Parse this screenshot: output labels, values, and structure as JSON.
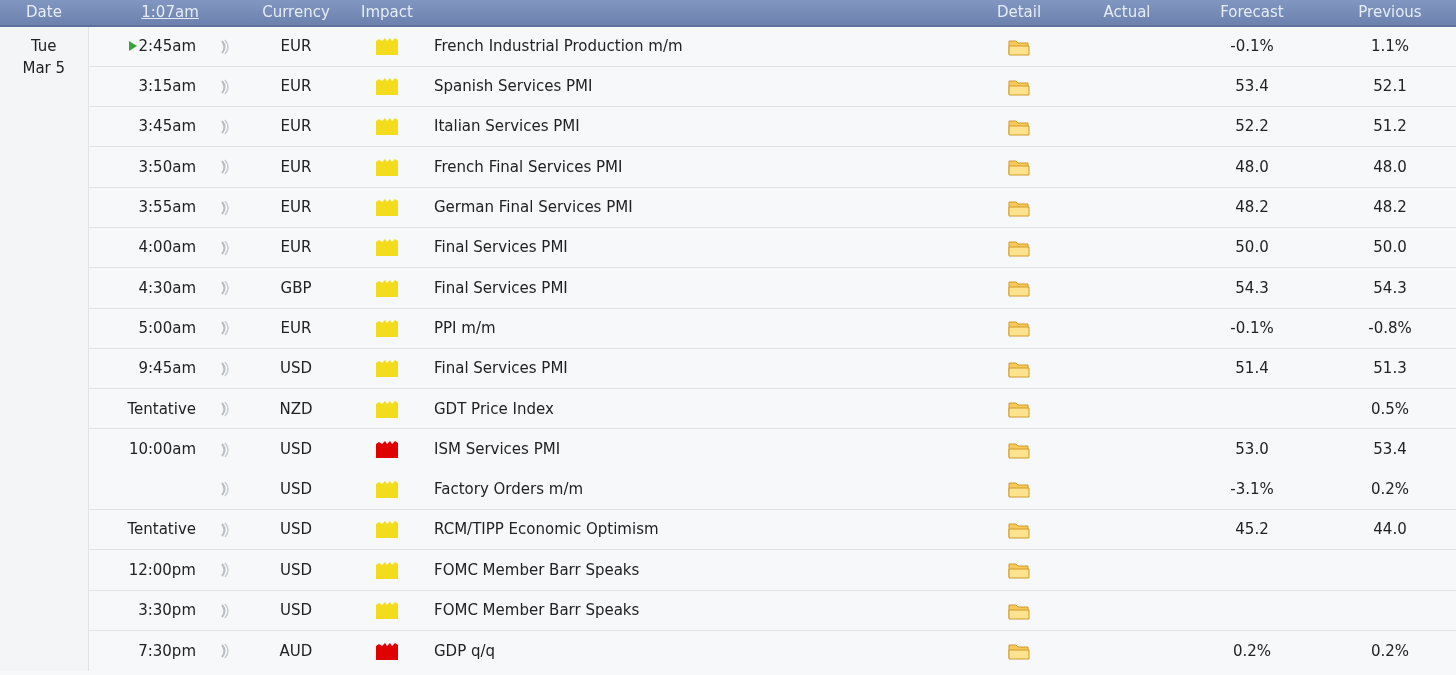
{
  "header": {
    "date": "Date",
    "time": "1:07am",
    "currency": "Currency",
    "impact": "Impact",
    "detail": "Detail",
    "actual": "Actual",
    "forecast": "Forecast",
    "previous": "Previous"
  },
  "day": {
    "weekday": "Tue",
    "date": "Mar 5"
  },
  "rows": [
    {
      "time": "2:45am",
      "current": true,
      "currency": "EUR",
      "color": "#f2dc1c",
      "event": "French Industrial Production m/m",
      "forecast": "-0.1%",
      "previous": "1.1%"
    },
    {
      "time": "3:15am",
      "current": false,
      "currency": "EUR",
      "color": "#f2dc1c",
      "event": "Spanish Services PMI",
      "forecast": "53.4",
      "previous": "52.1"
    },
    {
      "time": "3:45am",
      "current": false,
      "currency": "EUR",
      "color": "#f2dc1c",
      "event": "Italian Services PMI",
      "forecast": "52.2",
      "previous": "51.2"
    },
    {
      "time": "3:50am",
      "current": false,
      "currency": "EUR",
      "color": "#f2dc1c",
      "event": "French Final Services PMI",
      "forecast": "48.0",
      "previous": "48.0"
    },
    {
      "time": "3:55am",
      "current": false,
      "currency": "EUR",
      "color": "#f2dc1c",
      "event": "German Final Services PMI",
      "forecast": "48.2",
      "previous": "48.2"
    },
    {
      "time": "4:00am",
      "current": false,
      "currency": "EUR",
      "color": "#f2dc1c",
      "event": "Final Services PMI",
      "forecast": "50.0",
      "previous": "50.0"
    },
    {
      "time": "4:30am",
      "current": false,
      "currency": "GBP",
      "color": "#f2dc1c",
      "event": "Final Services PMI",
      "forecast": "54.3",
      "previous": "54.3"
    },
    {
      "time": "5:00am",
      "current": false,
      "currency": "EUR",
      "color": "#f2dc1c",
      "event": "PPI m/m",
      "forecast": "-0.1%",
      "previous": "-0.8%"
    },
    {
      "time": "9:45am",
      "current": false,
      "currency": "USD",
      "color": "#f2dc1c",
      "event": "Final Services PMI",
      "forecast": "51.4",
      "previous": "51.3"
    },
    {
      "time": "Tentative",
      "current": false,
      "currency": "NZD",
      "color": "#f2dc1c",
      "event": "GDT Price Index",
      "previous": "0.5%"
    },
    {
      "time": "10:00am",
      "current": false,
      "currency": "USD",
      "color": "#e00000",
      "event": "ISM Services PMI",
      "forecast": "53.0",
      "previous": "53.4"
    },
    {
      "current": false,
      "currency": "USD",
      "color": "#f2dc1c",
      "event": "Factory Orders m/m",
      "forecast": "-3.1%",
      "previous": "0.2%"
    },
    {
      "time": "Tentative",
      "current": false,
      "currency": "USD",
      "color": "#f2dc1c",
      "event": "RCM/TIPP Economic Optimism",
      "forecast": "45.2",
      "previous": "44.0"
    },
    {
      "time": "12:00pm",
      "current": false,
      "currency": "USD",
      "color": "#f2dc1c",
      "event": "FOMC Member Barr Speaks"
    },
    {
      "time": "3:30pm",
      "current": false,
      "currency": "USD",
      "color": "#f2dc1c",
      "event": "FOMC Member Barr Speaks"
    },
    {
      "time": "7:30pm",
      "current": false,
      "currency": "AUD",
      "color": "#e00000",
      "event": "GDP q/q",
      "forecast": "0.2%",
      "previous": "0.2%"
    }
  ]
}
